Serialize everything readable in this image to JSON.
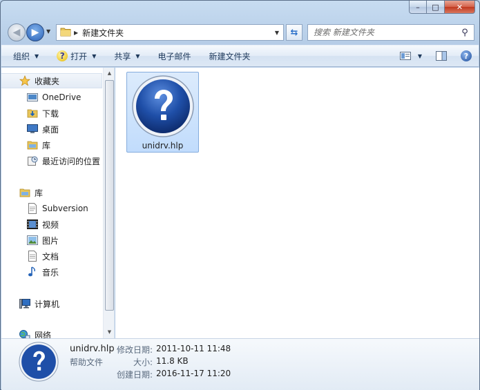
{
  "window": {
    "caption": {
      "minimize": "–",
      "maximize": "□",
      "close": "✕"
    }
  },
  "address_bar": {
    "path": [
      "新建文件夹"
    ],
    "current": "新建文件夹"
  },
  "search": {
    "placeholder": "搜索 新建文件夹"
  },
  "toolbar": {
    "organize": "组织",
    "open": "打开",
    "share": "共享",
    "email": "电子邮件",
    "new_folder": "新建文件夹"
  },
  "sidebar": {
    "favorites": {
      "label": "收藏夹",
      "items": [
        "OneDrive",
        "下载",
        "桌面",
        "库",
        "最近访问的位置"
      ]
    },
    "libraries": {
      "label": "库",
      "items": [
        "Subversion",
        "视频",
        "图片",
        "文档",
        "音乐"
      ]
    },
    "computer": {
      "label": "计算机"
    },
    "network": {
      "label": "网络"
    }
  },
  "files": [
    {
      "name": "unidrv.hlp",
      "icon": "help-file-icon"
    }
  ],
  "details": {
    "name": "unidrv.hlp",
    "type": "帮助文件",
    "modified_label": "修改日期:",
    "modified": "2011-10-11 11:48",
    "size_label": "大小:",
    "size": "11.8 KB",
    "created_label": "创建日期:",
    "created": "2016-11-17 11:20"
  },
  "colors": {
    "selection": "#c1dcfc",
    "selection_border": "#84acdd",
    "chrome": "#b6cde7"
  }
}
